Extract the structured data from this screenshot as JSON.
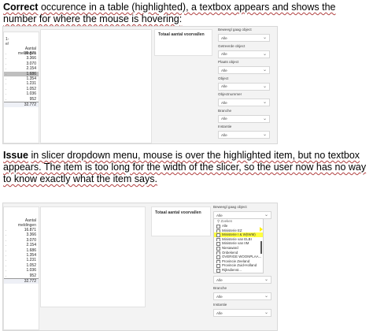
{
  "captions": {
    "top_lead": "Correct",
    "top_rest": "occurence in a table (highlighted), a textbox appears and shows the number for where the mouse is hovering:",
    "bottom_lead": "Issue",
    "bottom_rest": "in slicer dropdown menu, mouse is over the highlighted item, but no textbox appears. The item is too long for the width of the slicer, so the user now has no way to know exactly what the item says."
  },
  "top": {
    "table": {
      "header_prefix": "1-\ne/",
      "header": "Aantal\nmeldingen",
      "rows": [
        "16.871",
        "3.366",
        "3.070",
        "2.154",
        "1.686",
        "1.354",
        "1.231",
        "1.052",
        "1.036",
        "952"
      ],
      "highlight_index": 4,
      "tooltip_index": 5,
      "total": "32.772"
    },
    "card_title": "Totaal aantal voorvallen",
    "slicers": [
      {
        "label": "Beweegl gaag object",
        "value": "Alle"
      },
      {
        "label": "Getreerde object",
        "value": "Alle"
      },
      {
        "label": "Plaats object",
        "value": "Alle"
      },
      {
        "label": "Object",
        "value": "Alle"
      },
      {
        "label": "Objectnummer",
        "value": "Alle"
      },
      {
        "label": "Branche",
        "value": "Alle"
      },
      {
        "label": "Instantie",
        "value": "Alle"
      }
    ]
  },
  "bottom": {
    "table": {
      "header": "Aantal\nmeldingen",
      "rows": [
        "16.871",
        "3.366",
        "3.070",
        "2.154",
        "1.686",
        "1.354",
        "1.231",
        "1.052",
        "1.036",
        "952"
      ],
      "total": "32.772"
    },
    "card_title": "Totaal aantal voorvallen",
    "slicer_top": {
      "label": "Beweegl gaag object",
      "value": "Alle"
    },
    "dropdown": {
      "search": "Zoeken",
      "items": [
        "Alle",
        "Ministerie EZ",
        "Ministerie I & W(IWM)",
        "Ministerie van ELBI",
        "Ministerie van IIM",
        "Niesaward",
        "Onbekend",
        "OVERIGE WOONPLAA...",
        "Provincie Zeeland",
        "Provincie Zuid-Holland",
        "Rijksdienst..."
      ],
      "highlight_index": 2
    },
    "slicers": [
      {
        "label": "",
        "value": "Alle"
      },
      {
        "label": "Branche",
        "value": "Alle"
      },
      {
        "label": "Instantie",
        "value": "Alle"
      }
    ]
  },
  "colors": {
    "highlight_row": "#bfbfbf",
    "tooltip_yellow": "#f7f07a",
    "dropdown_highlight": "#ffff40",
    "squiggle": "#b04040"
  },
  "icons": {
    "chevron": "chevron-down-icon",
    "search": "search-icon",
    "cursor": "mouse-cursor-icon"
  }
}
